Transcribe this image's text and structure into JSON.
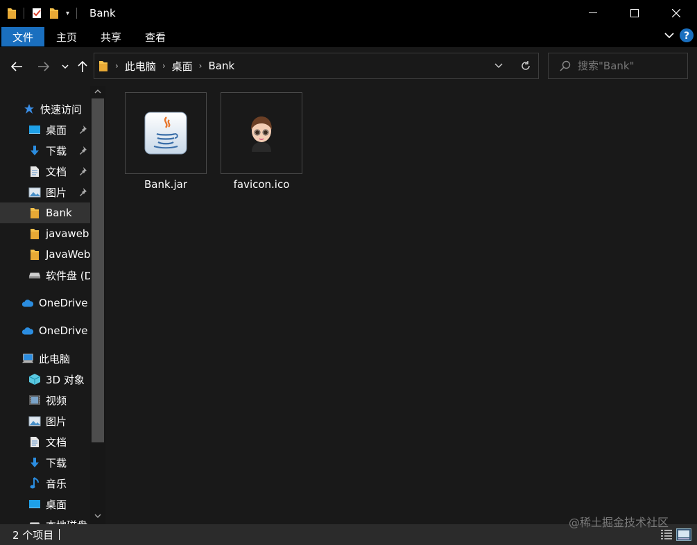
{
  "window": {
    "title": "Bank"
  },
  "ribbon": {
    "tabs": [
      "文件",
      "主页",
      "共享",
      "查看"
    ]
  },
  "address": {
    "crumbs": [
      "此电脑",
      "桌面",
      "Bank"
    ]
  },
  "search": {
    "placeholder": "搜索\"Bank\""
  },
  "sidebar": {
    "quick_access": "快速访问",
    "items": [
      {
        "label": "桌面",
        "icon": "desktop-icon",
        "pinned": true
      },
      {
        "label": "下载",
        "icon": "download-icon",
        "pinned": true
      },
      {
        "label": "文档",
        "icon": "document-icon",
        "pinned": true
      },
      {
        "label": "图片",
        "icon": "picture-icon",
        "pinned": true
      },
      {
        "label": "Bank",
        "icon": "folder-icon",
        "selected": true
      },
      {
        "label": "javaweb",
        "icon": "folder-icon"
      },
      {
        "label": "JavaWeb",
        "icon": "folder-icon"
      },
      {
        "label": "软件盘 (D",
        "icon": "drive-icon"
      }
    ],
    "onedrive1": "OneDrive -",
    "onedrive2": "OneDrive -",
    "this_pc": "此电脑",
    "pc_items": [
      {
        "label": "3D 对象",
        "icon": "3d-objects-icon"
      },
      {
        "label": "视频",
        "icon": "video-icon"
      },
      {
        "label": "图片",
        "icon": "picture-icon"
      },
      {
        "label": "文档",
        "icon": "document-icon"
      },
      {
        "label": "下载",
        "icon": "download-icon"
      },
      {
        "label": "音乐",
        "icon": "music-icon"
      },
      {
        "label": "桌面",
        "icon": "desktop-icon"
      },
      {
        "label": "本地磁盘",
        "icon": "drive-icon"
      }
    ]
  },
  "files": [
    {
      "name": "Bank.jar",
      "icon": "java-icon"
    },
    {
      "name": "favicon.ico",
      "icon": "avatar-icon"
    }
  ],
  "status": {
    "count": "2 个项目"
  },
  "watermark": "@稀土掘金技术社区",
  "colors": {
    "accent": "#1a6fbf",
    "background": "#191919",
    "folder": "#f5c04a"
  }
}
